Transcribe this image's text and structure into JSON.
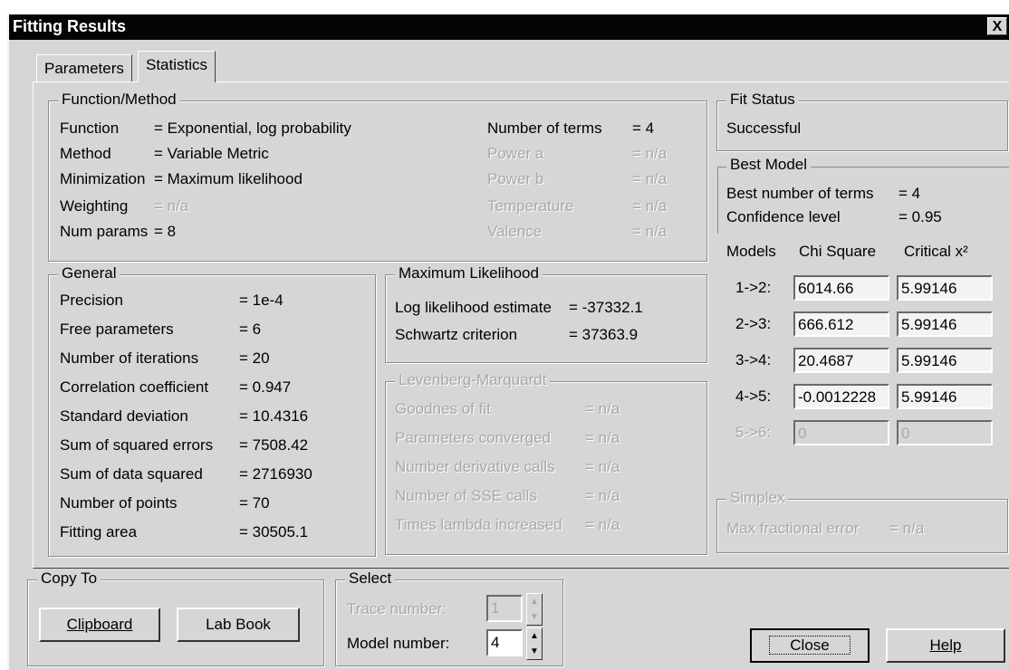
{
  "window": {
    "title": "Fitting Results",
    "close_glyph": "X"
  },
  "tabs": [
    "Parameters",
    "Statistics"
  ],
  "function_method": {
    "legend": "Function/Method",
    "rows": [
      {
        "label": "Function",
        "value": "= Exponential, log probability",
        "enabled": true
      },
      {
        "label": "Method",
        "value": "= Variable Metric",
        "enabled": true
      },
      {
        "label": "Minimization",
        "value": "= Maximum likelihood",
        "enabled": true
      },
      {
        "label": "Weighting",
        "value": "= n/a",
        "enabled": false
      },
      {
        "label": "Num params",
        "value": "= 8",
        "enabled": true
      }
    ],
    "right_rows": [
      {
        "label": "Number of terms",
        "value": "= 4",
        "enabled": true
      },
      {
        "label": "Power a",
        "value": "= n/a",
        "enabled": false
      },
      {
        "label": "Power b",
        "value": "= n/a",
        "enabled": false
      },
      {
        "label": "Temperature",
        "value": "= n/a",
        "enabled": false
      },
      {
        "label": "Valence",
        "value": "= n/a",
        "enabled": false
      }
    ]
  },
  "general": {
    "legend": "General",
    "rows": [
      {
        "label": "Precision",
        "value": "= 1e-4"
      },
      {
        "label": "Free parameters",
        "value": "= 6"
      },
      {
        "label": "Number of iterations",
        "value": "= 20"
      },
      {
        "label": "Correlation coefficient",
        "value": "= 0.947"
      },
      {
        "label": "Standard deviation",
        "value": "= 10.4316"
      },
      {
        "label": "Sum of squared errors",
        "value": "= 7508.42"
      },
      {
        "label": "Sum of data squared",
        "value": "= 2716930"
      },
      {
        "label": "Number of points",
        "value": "= 70"
      },
      {
        "label": "Fitting area",
        "value": "= 30505.1"
      }
    ]
  },
  "max_likelihood": {
    "legend": "Maximum Likelihood",
    "rows": [
      {
        "label": "Log likelihood estimate",
        "value": "= -37332.1"
      },
      {
        "label": "Schwartz criterion",
        "value": "= 37363.9"
      }
    ]
  },
  "lm": {
    "legend": "Levenberg-Marquardt",
    "rows": [
      {
        "label": "Goodnes of fit",
        "value": "= n/a"
      },
      {
        "label": "Parameters converged",
        "value": "= n/a"
      },
      {
        "label": "Number derivative calls",
        "value": "= n/a"
      },
      {
        "label": "Number of SSE calls",
        "value": "= n/a"
      },
      {
        "label": "Times lambda increased",
        "value": "= n/a"
      }
    ]
  },
  "fit_status": {
    "legend": "Fit Status",
    "value": "Successful"
  },
  "best_model": {
    "legend": "Best Model",
    "best_terms_label": "Best number of terms",
    "best_terms_value": "= 4",
    "confidence_label": "Confidence level",
    "confidence_value": "= 0.95",
    "col_models": "Models",
    "col_chi": "Chi Square",
    "col_critical": "Critical x²",
    "rows": [
      {
        "model": "1->2:",
        "chi": "6014.66",
        "critical": "5.99146",
        "enabled": true
      },
      {
        "model": "2->3:",
        "chi": "666.612",
        "critical": "5.99146",
        "enabled": true
      },
      {
        "model": "3->4:",
        "chi": "20.4687",
        "critical": "5.99146",
        "enabled": true
      },
      {
        "model": "4->5:",
        "chi": "-0.0012228",
        "critical": "5.99146",
        "enabled": true
      },
      {
        "model": "5->6:",
        "chi": "0",
        "critical": "0",
        "enabled": false
      }
    ]
  },
  "simplex": {
    "legend": "Simplex",
    "label": "Max fractional error",
    "value": "= n/a"
  },
  "copy_to": {
    "legend": "Copy To",
    "clipboard": "Clipboard",
    "labbook": "Lab Book"
  },
  "select": {
    "legend": "Select",
    "trace_label": "Trace number:",
    "trace_value": "1",
    "model_label": "Model number:",
    "model_value": "4"
  },
  "buttons": {
    "close": "Close",
    "help": "Help"
  }
}
